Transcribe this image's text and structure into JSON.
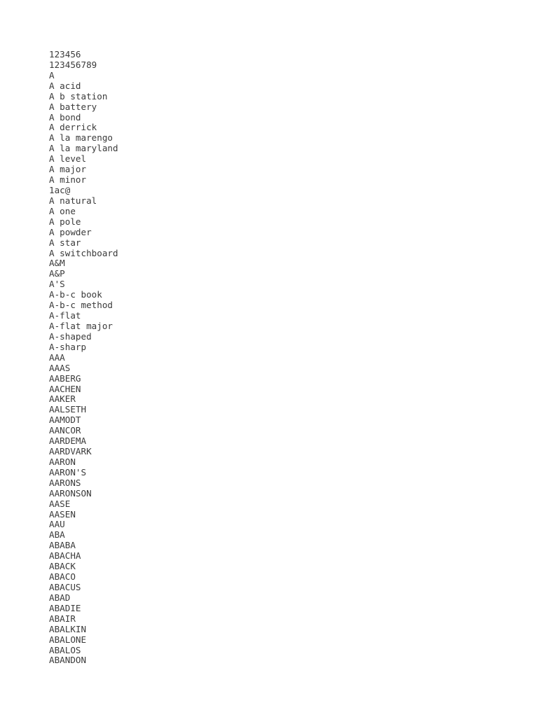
{
  "document": {
    "type": "plain-text-word-list",
    "background_color": "#ffffff",
    "text_color": "#3a3a3a",
    "line_count": 58,
    "lines": [
      "123456",
      "123456789",
      "A",
      "A acid",
      "A b station",
      "A battery",
      "A bond",
      "A derrick",
      "A la marengo",
      "A la maryland",
      "A level",
      "A major",
      "A minor",
      "1ac@",
      "A natural",
      "A one",
      "A pole",
      "A powder",
      "A star",
      "A switchboard",
      "A&M",
      "A&P",
      "A'S",
      "A-b-c book",
      "A-b-c method",
      "A-flat",
      "A-flat major",
      "A-shaped",
      "A-sharp",
      "AAA",
      "AAAS",
      "AABERG",
      "AACHEN",
      "AAKER",
      "AALSETH",
      "AAMODT",
      "AANCOR",
      "AARDEMA",
      "AARDVARK",
      "AARON",
      "AARON'S",
      "AARONS",
      "AARONSON",
      "AASE",
      "AASEN",
      "AAU",
      "ABA",
      "ABABA",
      "ABACHA",
      "ABACK",
      "ABACO",
      "ABACUS",
      "ABAD",
      "ABADIE",
      "ABAIR",
      "ABALKIN",
      "ABALONE",
      "ABALOS",
      "ABANDON"
    ]
  }
}
